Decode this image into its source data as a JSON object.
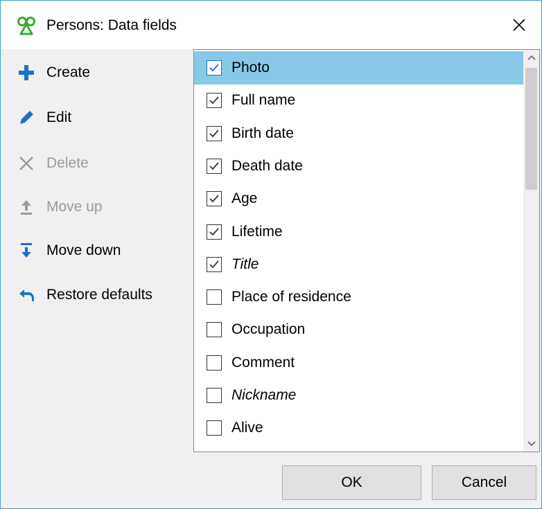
{
  "window": {
    "title": "Persons: Data fields",
    "accent": "#3d9fd8"
  },
  "sidebar": {
    "items": [
      {
        "label": "Create",
        "icon": "plus-icon",
        "enabled": true
      },
      {
        "label": "Edit",
        "icon": "pencil-icon",
        "enabled": true
      },
      {
        "label": "Delete",
        "icon": "x-icon",
        "enabled": false
      },
      {
        "label": "Move up",
        "icon": "move-up-icon",
        "enabled": false
      },
      {
        "label": "Move down",
        "icon": "move-down-icon",
        "enabled": true
      },
      {
        "label": "Restore defaults",
        "icon": "undo-icon",
        "enabled": true
      }
    ]
  },
  "fields": [
    {
      "label": "Photo",
      "checked": true,
      "italic": false,
      "selected": true
    },
    {
      "label": "Full name",
      "checked": true,
      "italic": false,
      "selected": false
    },
    {
      "label": "Birth date",
      "checked": true,
      "italic": false,
      "selected": false
    },
    {
      "label": "Death date",
      "checked": true,
      "italic": false,
      "selected": false
    },
    {
      "label": "Age",
      "checked": true,
      "italic": false,
      "selected": false
    },
    {
      "label": "Lifetime",
      "checked": true,
      "italic": false,
      "selected": false
    },
    {
      "label": "Title",
      "checked": true,
      "italic": true,
      "selected": false
    },
    {
      "label": "Place of residence",
      "checked": false,
      "italic": false,
      "selected": false
    },
    {
      "label": "Occupation",
      "checked": false,
      "italic": false,
      "selected": false
    },
    {
      "label": "Comment",
      "checked": false,
      "italic": false,
      "selected": false
    },
    {
      "label": "Nickname",
      "checked": false,
      "italic": true,
      "selected": false
    },
    {
      "label": "Alive",
      "checked": false,
      "italic": false,
      "selected": false
    }
  ],
  "buttons": {
    "ok": "OK",
    "cancel": "Cancel"
  },
  "colors": {
    "selection": "#88c9e8",
    "icon_blue": "#1a73c9",
    "disabled_text": "#9a9a9a"
  }
}
